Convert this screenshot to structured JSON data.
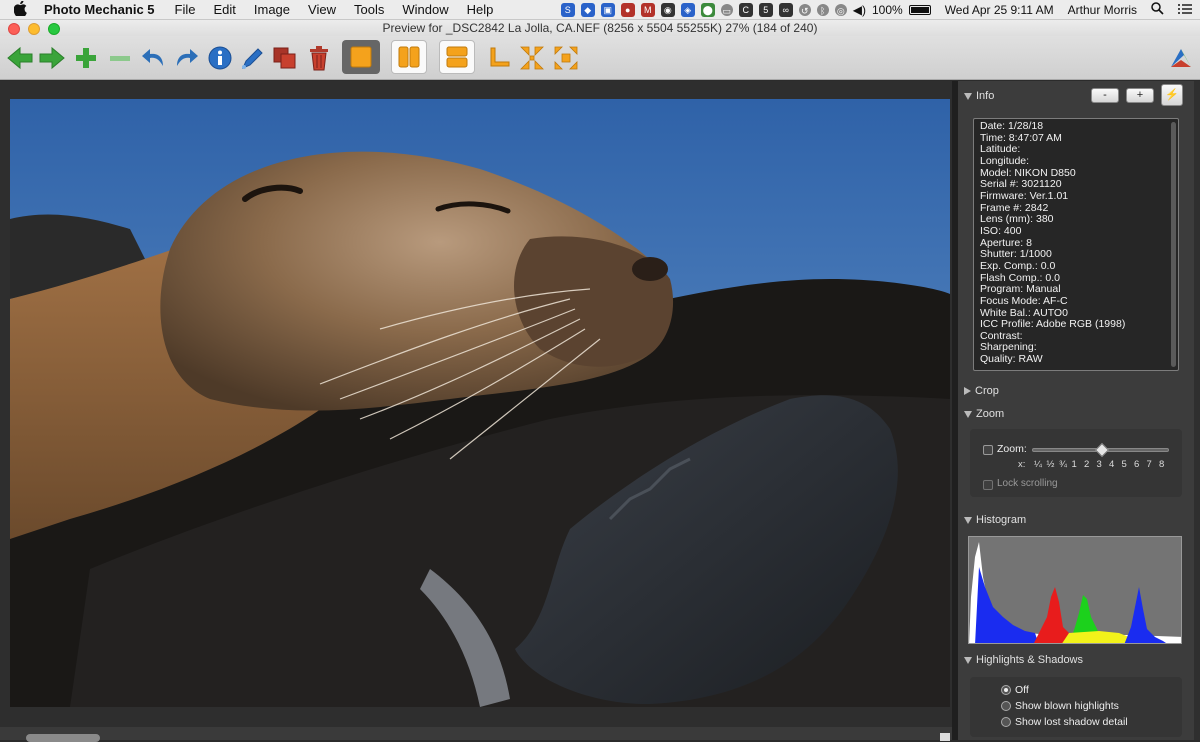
{
  "menubar": {
    "app_name": "Photo Mechanic 5",
    "items": [
      "File",
      "Edit",
      "Image",
      "View",
      "Tools",
      "Window",
      "Help"
    ],
    "status": {
      "battery": "100%",
      "clock": "Wed Apr 25  9:11 AM",
      "user": "Arthur Morris"
    }
  },
  "window": {
    "title": "Preview for _DSC2842  La  Jolla, CA.NEF (8256 x 5504 55255K) 27% (184 of 240)"
  },
  "toolbar": {
    "icons": [
      "back-arrow-icon",
      "forward-arrow-icon",
      "plus-icon",
      "minus-icon",
      "undo-icon",
      "redo-icon",
      "info-icon",
      "color-picker-icon",
      "duplicate-icon",
      "trash-icon",
      "single-view-icon",
      "side-by-side-icon",
      "top-bottom-icon",
      "crop-corner-icon",
      "shrink-icon",
      "expand-icon",
      "app-logo-icon"
    ]
  },
  "panel": {
    "info": {
      "title": "Info",
      "minus_label": "-",
      "plus_label": "+",
      "bolt_label": "⚡",
      "lines": [
        "Date: 1/28/18",
        "Time: 8:47:07 AM",
        "Latitude:",
        "Longitude:",
        "Model: NIKON D850",
        "Serial #: 3021120",
        "Firmware: Ver.1.01",
        "Frame #: 2842",
        "Lens (mm): 380",
        "ISO: 400",
        "Aperture: 8",
        "Shutter: 1/1000",
        "Exp. Comp.: 0.0",
        "Flash Comp.: 0.0",
        "Program: Manual",
        "Focus Mode: AF-C",
        "White Bal.: AUTO0",
        "ICC Profile: Adobe RGB (1998)",
        "Contrast:",
        "Sharpening:",
        "Quality: RAW"
      ]
    },
    "crop": {
      "title": "Crop"
    },
    "zoom": {
      "title": "Zoom",
      "zoom_label": "Zoom:",
      "x_label": "x:",
      "ticks": [
        "¼",
        "½",
        "¾",
        "1",
        "2",
        "3",
        "4",
        "5",
        "6",
        "7",
        "8"
      ],
      "lock_label": "Lock scrolling"
    },
    "histogram": {
      "title": "Histogram"
    },
    "highlights": {
      "title": "Highlights & Shadows",
      "options": [
        "Off",
        "Show blown highlights",
        "Show lost shadow detail"
      ],
      "selected": "Off"
    }
  }
}
